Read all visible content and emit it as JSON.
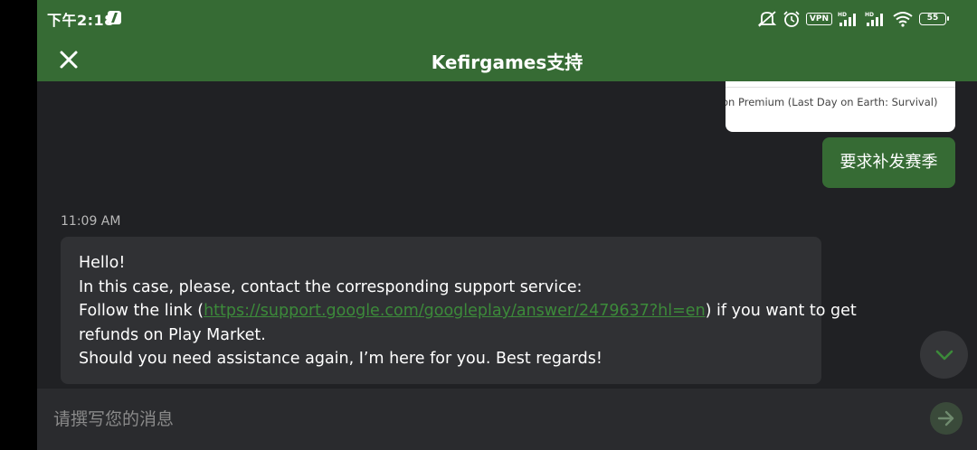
{
  "status_bar": {
    "time": "下午2:18",
    "vpn": "VPN",
    "battery": "55"
  },
  "header": {
    "title": "Kefirgames支持"
  },
  "chat": {
    "product_card_text": "on Premium (Last Day on Earth: Survival)",
    "user_message": "要求补发赛季",
    "timestamp": "11:09 AM",
    "support_message": {
      "line1": "Hello!",
      "line2": "In this case, please, contact the corresponding support service:",
      "line3_before": "Follow the link (",
      "link": "https://support.google.com/googleplay/answer/2479637?hl=en",
      "line3_after": ") if you want to get",
      "line4": "refunds on Play Market.",
      "line5": "Should you need assistance again, I’m here for you. Best regards!"
    }
  },
  "composer": {
    "placeholder": "请撰写您的消息"
  },
  "colors": {
    "primary": "#366b34",
    "background": "#202124",
    "bubble": "#303134",
    "link": "#3c8a3a"
  },
  "icons": [
    "close-icon",
    "chevron-down-icon",
    "send-arrow-icon",
    "mute-icon",
    "alarm-icon",
    "signal-icon",
    "wifi-icon",
    "battery-icon"
  ]
}
